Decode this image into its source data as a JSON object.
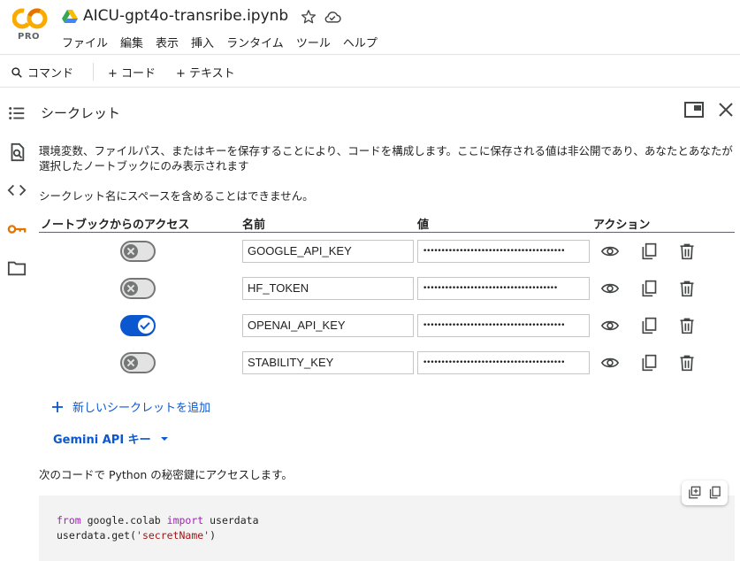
{
  "app": {
    "logo_text": "CO",
    "logo_badge": "PRO",
    "notebook_title": "AICU-gpt4o-transribe.ipynb"
  },
  "menu": [
    "ファイル",
    "編集",
    "表示",
    "挿入",
    "ランタイム",
    "ツール",
    "ヘルプ"
  ],
  "toolbar": {
    "command_label": "コマンド",
    "add_code_label": "+ コード",
    "add_text_label": "+ テキスト"
  },
  "panel": {
    "title": "シークレット",
    "description": "環境変数、ファイルパス、またはキーを保存することにより、コードを構成します。ここに保存される値は非公開であり、あなたとあなたが選択したノートブックにのみ表示されます",
    "note": "シークレット名にスペースを含めることはできません。",
    "columns": {
      "access": "ノートブックからのアクセス",
      "name": "名前",
      "value": "値",
      "actions": "アクション"
    },
    "secrets": [
      {
        "enabled": false,
        "name": "GOOGLE_API_KEY",
        "value": "•••••••••••••••••••••••••••••••••••••••"
      },
      {
        "enabled": false,
        "name": "HF_TOKEN",
        "value": "•••••••••••••••••••••••••••••••••••••"
      },
      {
        "enabled": true,
        "name": "OPENAI_API_KEY",
        "value": "•••••••••••••••••••••••••••••••••••••••"
      },
      {
        "enabled": false,
        "name": "STABILITY_KEY",
        "value": "•••••••••••••••••••••••••••••••••••••••"
      }
    ],
    "add_secret_label": "新しいシークレットを追加",
    "gemini_label": "Gemini API キー",
    "code_intro": "次のコードで Python の秘密鍵にアクセスします。",
    "code": {
      "line1_kw1": "from",
      "line1_mod": " google.colab ",
      "line1_kw2": "import",
      "line1_name": " userdata",
      "line2_pre": "userdata.get(",
      "line2_str": "'secretName'",
      "line2_post": ")"
    }
  },
  "colors": {
    "accent": "#0b57d0",
    "logo_orange": "#f9ab00",
    "logo_dark": "#e37400",
    "toggle_off": "#747775"
  }
}
